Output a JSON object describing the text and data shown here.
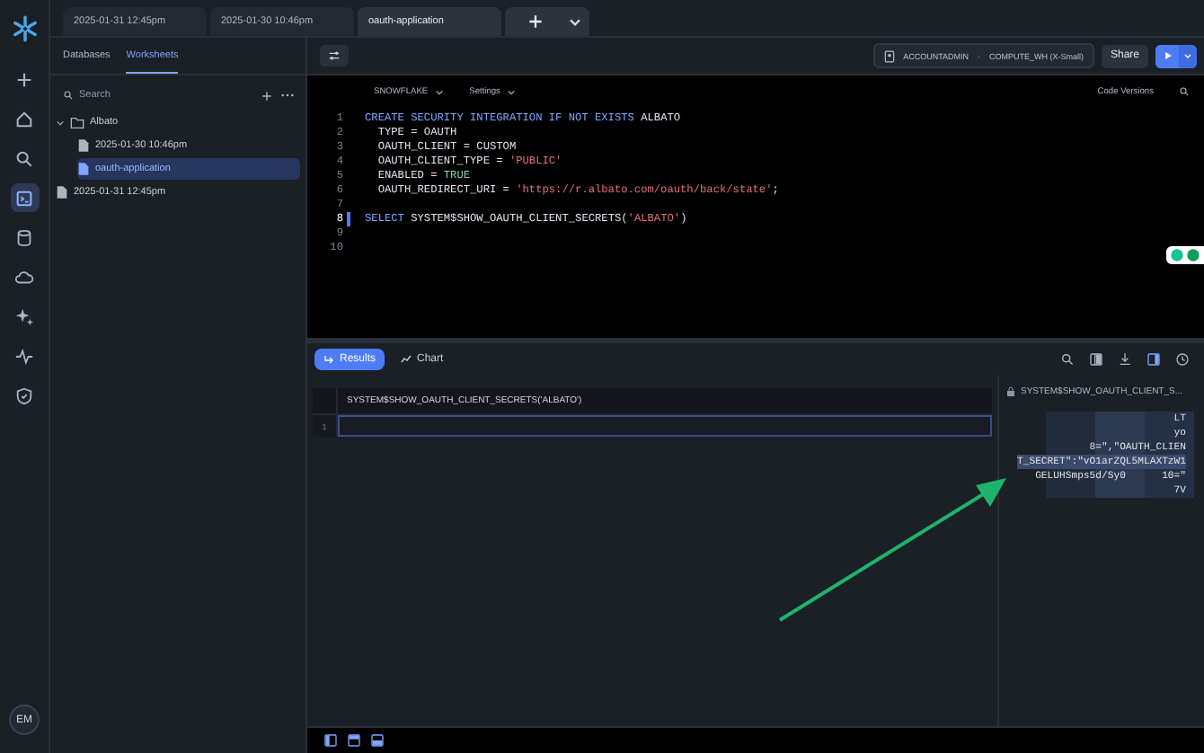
{
  "rail": {
    "items": [
      {
        "kind": "plus",
        "selected": false
      },
      {
        "kind": "home",
        "selected": false
      },
      {
        "kind": "search",
        "selected": false
      },
      {
        "kind": "worksheet",
        "selected": true
      },
      {
        "kind": "database",
        "selected": false
      },
      {
        "kind": "cloud",
        "selected": false
      },
      {
        "kind": "sparkle",
        "selected": false
      },
      {
        "kind": "activity",
        "selected": false
      },
      {
        "kind": "shield",
        "selected": false
      }
    ],
    "avatar": "EM"
  },
  "tabs": [
    {
      "label": "2025-01-31 12:45pm",
      "selected": false
    },
    {
      "label": "2025-01-30 10:46pm",
      "selected": false
    },
    {
      "label": "oauth-application",
      "selected": true
    }
  ],
  "sidebar": {
    "tabs": [
      {
        "label": "Databases",
        "selected": false
      },
      {
        "label": "Worksheets",
        "selected": true
      }
    ],
    "search": {
      "placeholder": "Search"
    },
    "tree": [
      {
        "label": "Albato",
        "kind": "folder",
        "expanded": true,
        "selected": false,
        "children": [
          {
            "label": "2025-01-30 10:46pm",
            "kind": "file",
            "selected": false
          },
          {
            "label": "oauth-application",
            "kind": "file",
            "selected": true
          }
        ]
      },
      {
        "label": "2025-01-31 12:45pm",
        "kind": "file",
        "selected": false
      }
    ]
  },
  "toolbar": {
    "role": "ACCOUNTADMIN",
    "separator": "·",
    "warehouse": "COMPUTE_WH (X-Small)",
    "share": "Share"
  },
  "editor": {
    "database": "SNOWFLAKE",
    "settings": "Settings",
    "versions": "Code Versions",
    "lines": [
      {
        "number": "1",
        "current": false,
        "tokens": [
          {
            "text": "CREATE SECURITY INTEGRATION IF NOT EXISTS",
            "kind": "keyword"
          },
          {
            "text": " ALBATO",
            "kind": "plain"
          }
        ]
      },
      {
        "number": "2",
        "current": false,
        "tokens": [
          {
            "text": "  TYPE = OAUTH",
            "kind": "plain"
          }
        ]
      },
      {
        "number": "3",
        "current": false,
        "tokens": [
          {
            "text": "  OAUTH_CLIENT = CUSTOM",
            "kind": "plain"
          }
        ]
      },
      {
        "number": "4",
        "current": false,
        "tokens": [
          {
            "text": "  OAUTH_CLIENT_TYPE = ",
            "kind": "plain"
          },
          {
            "text": "'PUBLIC'",
            "kind": "string"
          }
        ]
      },
      {
        "number": "5",
        "current": false,
        "tokens": [
          {
            "text": "  ENABLED = ",
            "kind": "plain"
          },
          {
            "text": "TRUE",
            "kind": "literal"
          }
        ]
      },
      {
        "number": "6",
        "current": false,
        "tokens": [
          {
            "text": "  OAUTH_REDIRECT_URI = ",
            "kind": "plain"
          },
          {
            "text": "'https://r.albato.com/oauth/back/state'",
            "kind": "string"
          },
          {
            "text": ";",
            "kind": "plain"
          }
        ]
      },
      {
        "number": "7",
        "current": false
      },
      {
        "number": "8",
        "current": true,
        "tokens": [
          {
            "text": "SELECT",
            "kind": "keyword"
          },
          {
            "text": " SYSTEM$SHOW_OAUTH_CLIENT_SECRETS(",
            "kind": "plain"
          },
          {
            "text": "'ALBATO'",
            "kind": "string"
          },
          {
            "text": ")",
            "kind": "plain"
          }
        ]
      },
      {
        "number": "9",
        "current": false
      },
      {
        "number": "10",
        "current": false
      }
    ]
  },
  "results": {
    "tabs": [
      {
        "label": "Results",
        "selected": true
      },
      {
        "label": "Chart",
        "selected": false
      }
    ],
    "column": "SYSTEM$SHOW_OAUTH_CLIENT_SECRETS('ALBATO')",
    "row_number": "1",
    "detail": {
      "title": "SYSTEM$SHOW_OAUTH_CLIENT_S...",
      "lines": [
        "LT",
        "yo",
        "8=\",\"OAUTH_CLIEN",
        "T_SECRET\":\"vO1arZQL5MLAXTzW1",
        "GELUHSmps5d/Sy0      10=\"",
        "7V"
      ]
    }
  }
}
